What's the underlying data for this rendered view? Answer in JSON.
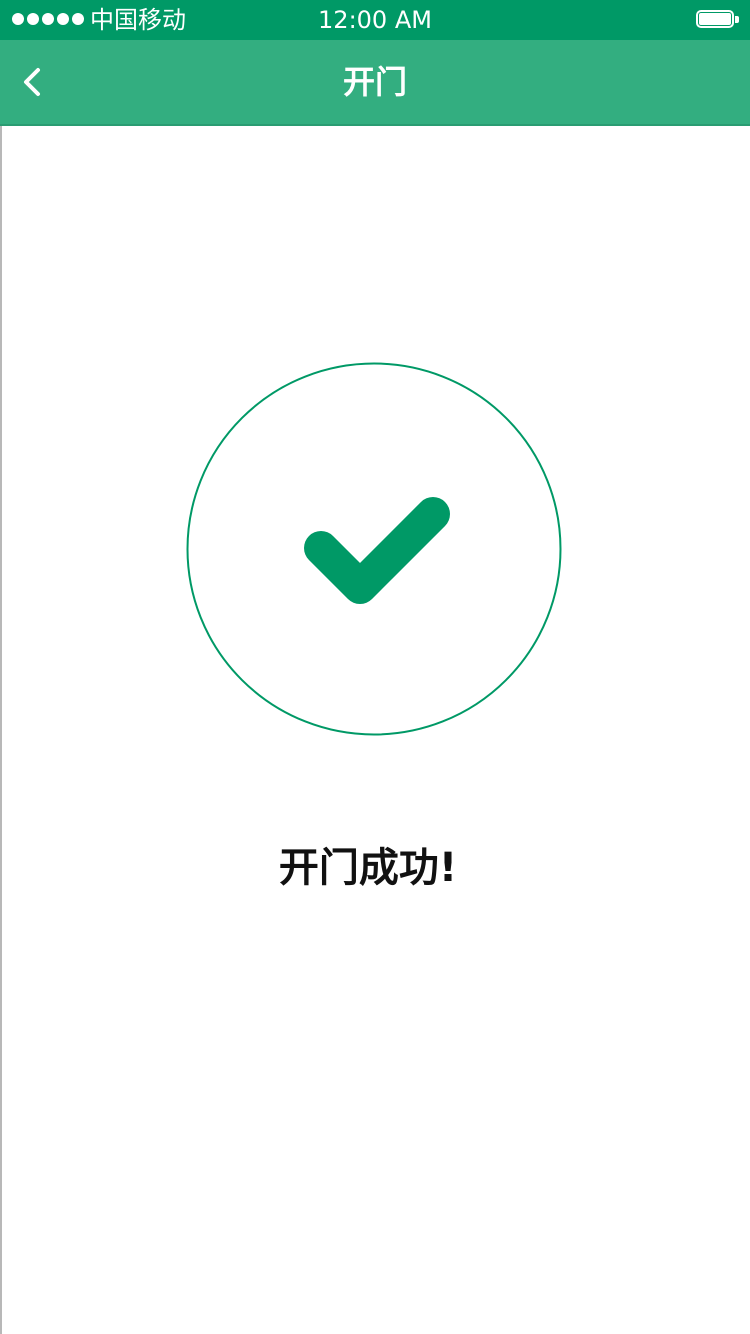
{
  "status_bar": {
    "carrier": "中国移动",
    "time": "12:00 AM",
    "signal_bars": 5,
    "battery_level": 1.0
  },
  "nav": {
    "title": "开门",
    "back_icon": "chevron-left-icon"
  },
  "main": {
    "success_icon": "check-circle-icon",
    "message": "开门成功!"
  },
  "colors": {
    "status_bar_bg": "#009966",
    "nav_bar_bg": "#33ae80",
    "accent": "#009966",
    "text": "#111111"
  }
}
